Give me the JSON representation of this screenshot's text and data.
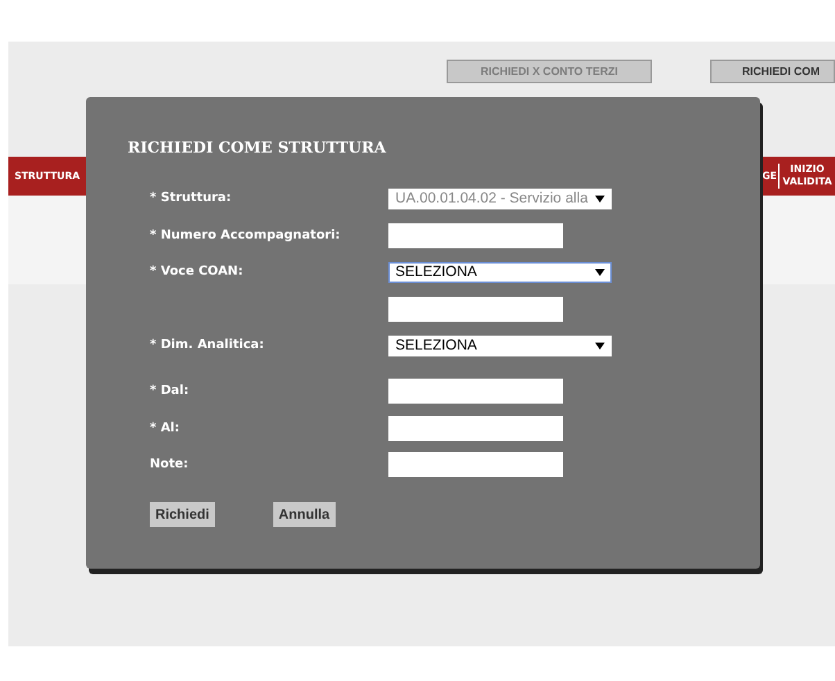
{
  "toolbar": {
    "buttons": [
      {
        "label": "RICHIEDI X CONTO TERZI",
        "disabled": true
      },
      {
        "label": "RICHIEDI COM",
        "disabled": false
      }
    ]
  },
  "table": {
    "columns": [
      "STRUTTURA",
      "GE",
      "INIZIO VALIDITA"
    ]
  },
  "dialog": {
    "title": "RICHIEDI COME STRUTTURA",
    "fields": [
      {
        "label": "* Struttura:",
        "kind": "select",
        "value": "UA.00.01.04.02 - Servizio alla",
        "disabled": true,
        "focused": false
      },
      {
        "label": "* Numero Accompagnatori:",
        "kind": "input"
      },
      {
        "label": "* Voce COAN:",
        "kind": "select",
        "value": "SELEZIONA",
        "disabled": false,
        "focused": true
      },
      {
        "kind": "input"
      },
      {
        "label": "* Dim. Analitica:",
        "kind": "select",
        "value": "SELEZIONA",
        "disabled": false,
        "focused": false
      },
      {
        "label": "* Dal:",
        "kind": "input"
      },
      {
        "label": "* Al:",
        "kind": "input"
      },
      {
        "label": "Note:",
        "kind": "input"
      }
    ],
    "buttons": [
      "Richiedi",
      "Annulla"
    ]
  }
}
